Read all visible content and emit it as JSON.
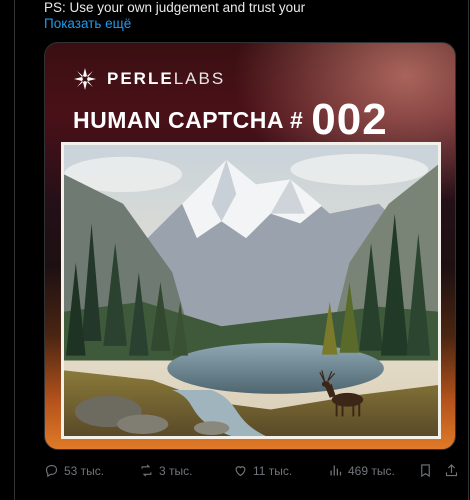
{
  "tweet": {
    "text": "PS: Use your own judgement and trust your",
    "show_more": "Показать ещё"
  },
  "media": {
    "brand_bold": "PERLE",
    "brand_light": "LABS",
    "headline": "HUMAN CAPTCHA #",
    "captcha_number": "002",
    "image_subject": "painting of a mountain valley with pine forest, lake and a deer"
  },
  "actions": {
    "replies": "53 тыс.",
    "reposts": "3 тыс.",
    "likes": "11 тыс.",
    "views": "469 тыс."
  },
  "icons": [
    "reply-icon",
    "repost-icon",
    "like-icon",
    "views-icon",
    "bookmark-icon",
    "share-icon"
  ],
  "colors": {
    "link": "#1d9bf0",
    "muted": "#71767b",
    "text": "#e7e9ea",
    "background": "#000000"
  }
}
